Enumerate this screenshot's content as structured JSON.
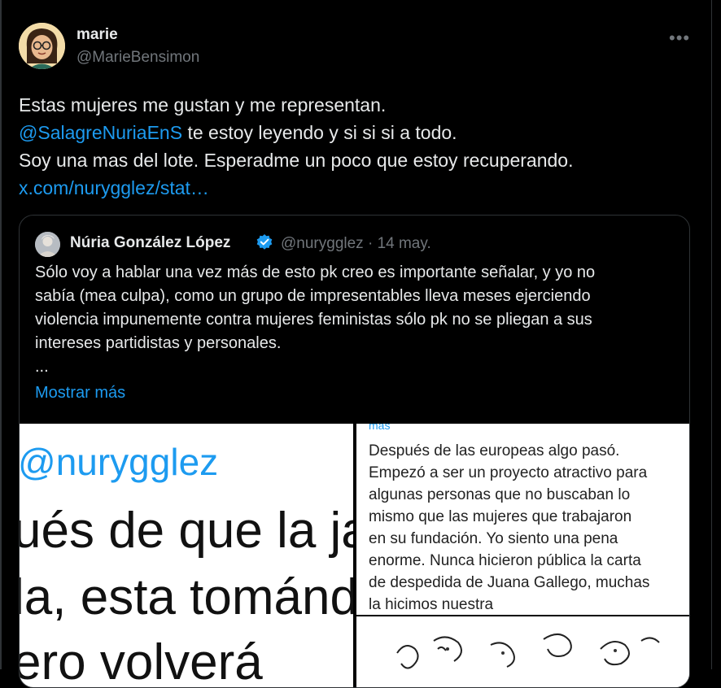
{
  "tweet": {
    "author_name": "marie",
    "author_handle": "@MarieBensimon",
    "more_icon": "more-horizontal-icon",
    "lines": [
      {
        "text": "Estas mujeres me gustan y me representan."
      },
      {
        "mention": "@SalagreNuriaEnS",
        "text": " te estoy leyendo y si si si a todo."
      },
      {
        "text": "Soy una mas del lote. Esperadme un poco que estoy recuperando."
      },
      {
        "link": "x.com/nurygglez/stat…"
      }
    ]
  },
  "quote": {
    "author_name": "Núria González López",
    "author_handle": "@nurygglez",
    "separator": "·",
    "date": "14 may.",
    "lines": [
      "Sólo voy a hablar una vez más de esto pk creo es importante señalar, y yo no",
      "sabía (mea culpa), como un grupo de impresentables lleva meses ejerciendo",
      "violencia impunemente contra mujeres feministas sólo pk no se pliegan a sus",
      "intereses partidistas y personales.",
      "..."
    ],
    "show_more": "Mostrar más"
  },
  "media": {
    "left": {
      "handle": "@nurygglez",
      "line1": "ués de que la ja",
      "line2": "la, esta tománd",
      "line3": "ero volverá"
    },
    "right_top": {
      "header": "más",
      "lines": [
        "Después de las europeas algo pasó.",
        "Empezó a ser un proyecto atractivo para",
        "algunas personas que no buscaban lo",
        "mismo que las mujeres que trabajaron",
        "en su fundación. Yo siento una pena",
        "enorme. Nunca hicieron pública la carta",
        "de despedida de Juana Gallego, muchas",
        "la hicimos nuestra"
      ]
    }
  },
  "colors": {
    "background": "#000000",
    "text": "#e7e9ea",
    "muted": "#71767b",
    "link": "#1d9bf0",
    "border": "#2f3336"
  }
}
